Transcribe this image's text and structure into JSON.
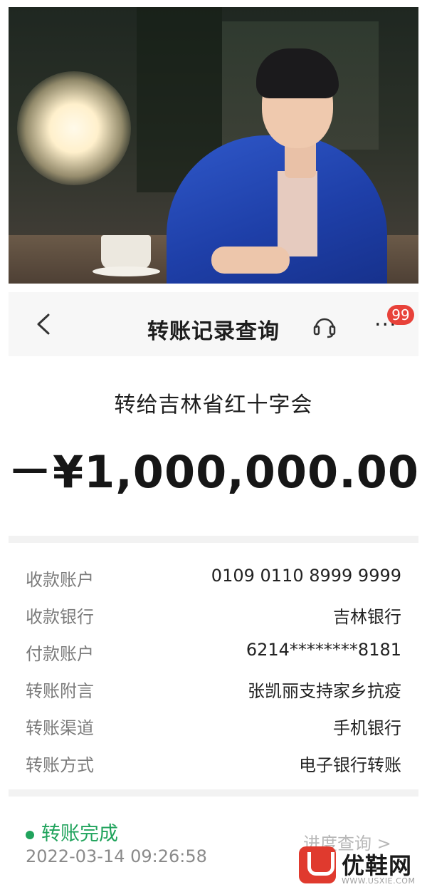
{
  "nav": {
    "title": "转账记录查询",
    "badge": "99",
    "more": "..."
  },
  "transfer": {
    "recipient": "转给吉林省红十字会",
    "amount": "－¥1,000,000.00"
  },
  "details": [
    {
      "label": "收款账户",
      "value": "0109 0110 8999 9999"
    },
    {
      "label": "收款银行",
      "value": "吉林银行"
    },
    {
      "label": "付款账户",
      "value": "6214********8181"
    },
    {
      "label": "转账附言",
      "value": "张凯丽支持家乡抗疫"
    },
    {
      "label": "转账渠道",
      "value": "手机银行"
    },
    {
      "label": "转账方式",
      "value": "电子银行转账"
    }
  ],
  "status": {
    "text": "转账完成",
    "time": "2022-03-14 09:26:58",
    "progress_link": "进度查询 >"
  },
  "watermark": {
    "brand": "优鞋网",
    "url": "WWW.USXIE.COM"
  },
  "colors": {
    "status_green": "#20a35c",
    "badge_red": "#e8423a"
  }
}
